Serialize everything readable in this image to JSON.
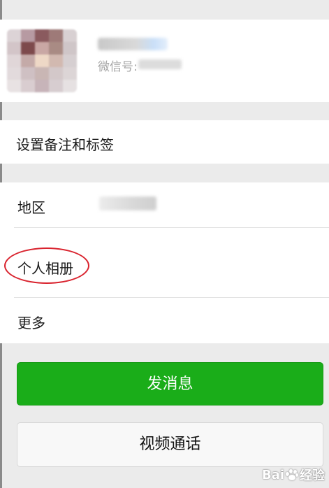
{
  "profile": {
    "wechat_id_label": "微信号:"
  },
  "rows": {
    "remark_label": "设置备注和标签",
    "region_label": "地区",
    "album_label": "个人相册",
    "more_label": "更多"
  },
  "actions": {
    "send_message": "发消息",
    "video_call": "视频通话"
  },
  "watermark": {
    "text_left": "Bai",
    "text_right": "经验"
  },
  "colors": {
    "primary_green": "#1aad19",
    "annotation_red": "#d9232e",
    "background": "#ebebeb"
  },
  "avatar_mosaic": [
    "#dcd3d6",
    "#b79aa2",
    "#8a5a5e",
    "#9e7a78",
    "#d8d0d2",
    "#d3c5c8",
    "#7d4a4c",
    "#c9a7a4",
    "#a98b84",
    "#cfc6c8",
    "#e0d6d8",
    "#c4aaa8",
    "#eed8c6",
    "#d2b9b0",
    "#d6cfd1",
    "#e2dadc",
    "#cfc0c3",
    "#c9b6b4",
    "#d3c8c9",
    "#dcd5d6",
    "#e8e2e3",
    "#d9cdd0",
    "#c7b4b9",
    "#d7cdd0",
    "#e6e1e2"
  ]
}
